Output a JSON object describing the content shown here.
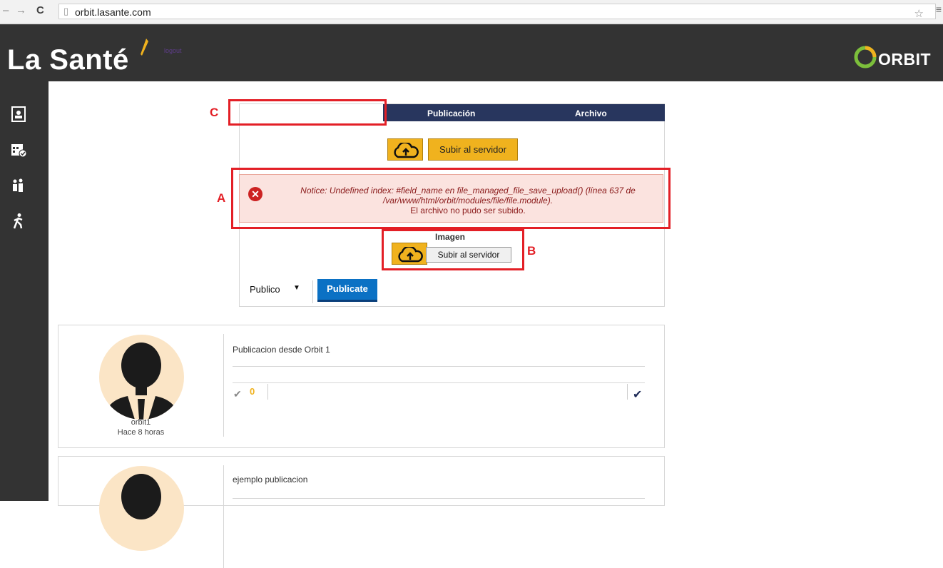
{
  "browser": {
    "url": "orbit.lasante.com",
    "back_icon": "arrow-left-icon",
    "forward_icon": "arrow-right-icon",
    "reload_icon": "reload-icon",
    "bookmark_icon": "star-icon",
    "menu_icon": "hamburger-icon"
  },
  "header": {
    "logo_text": "La Santé",
    "logout_text": "logout",
    "brand": "ORBIT"
  },
  "sidebar": {
    "icons": [
      "contact-card-icon",
      "calendar-check-icon",
      "people-group-icon",
      "walking-person-icon"
    ]
  },
  "composer": {
    "tabs": [
      "Publicación",
      "Archivo"
    ],
    "upload_button_label": "Subir al servidor",
    "error": {
      "line1": "Notice: Undefined index: #field_name en file_managed_file_save_upload() (línea 637 de",
      "line2": "/var/www/html/orbit/modules/file/file.module).",
      "line3": "El archivo no pudo ser subido."
    },
    "image_label": "Imagen",
    "file_button_label": "Subir al servidor",
    "visibility_value": "Publico",
    "publish_label": "Publicate"
  },
  "annotations": {
    "a": "A",
    "b": "B",
    "c": "C"
  },
  "posts": [
    {
      "text": "Publicacion desde Orbit 1",
      "user": "orbit1",
      "time": "Hace 8 horas",
      "likes": "0"
    },
    {
      "text": "ejemplo publicacion"
    }
  ],
  "colors": {
    "accent_yellow": "#f0b21e",
    "tab_navy": "#28365e",
    "publish_blue": "#0b71c4",
    "error_bg": "#fbe3df",
    "annotation_red": "#e31f26",
    "header_dark": "#333333"
  }
}
